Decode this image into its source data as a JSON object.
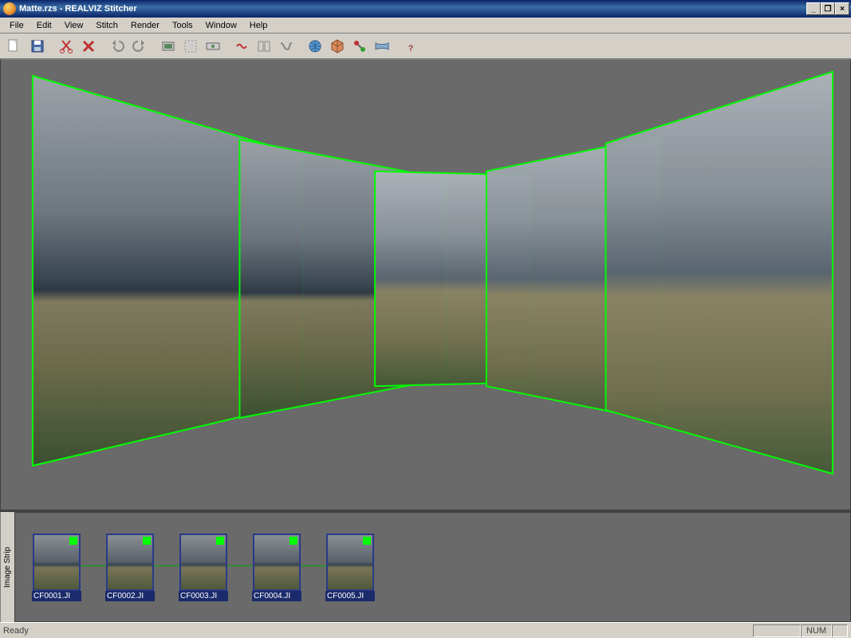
{
  "window": {
    "title": "Matte.rzs - REALVIZ Stitcher"
  },
  "menu": [
    "File",
    "Edit",
    "View",
    "Stitch",
    "Render",
    "Tools",
    "Window",
    "Help"
  ],
  "toolbar_icons": [
    "new-file-icon",
    "open-file-icon",
    "save-file-icon",
    "cut-icon",
    "delete-icon",
    "undo-icon",
    "redo-icon",
    "render-icon",
    "render-region-icon",
    "render-preview-icon",
    "stitch-icon",
    "align-icon",
    "warp-icon",
    "globe-icon",
    "cube-icon",
    "link-icon",
    "panorama-icon",
    "help-icon"
  ],
  "thumbnails": [
    {
      "label": "CF0001.JI"
    },
    {
      "label": "CF0002.JI"
    },
    {
      "label": "CF0003.JI"
    },
    {
      "label": "CF0004.JI"
    },
    {
      "label": "CF0005.JI"
    }
  ],
  "strip_label": "Image Strip",
  "statusbar": {
    "left": "Ready",
    "right": "NUM"
  },
  "frame_color": "#00ff00"
}
